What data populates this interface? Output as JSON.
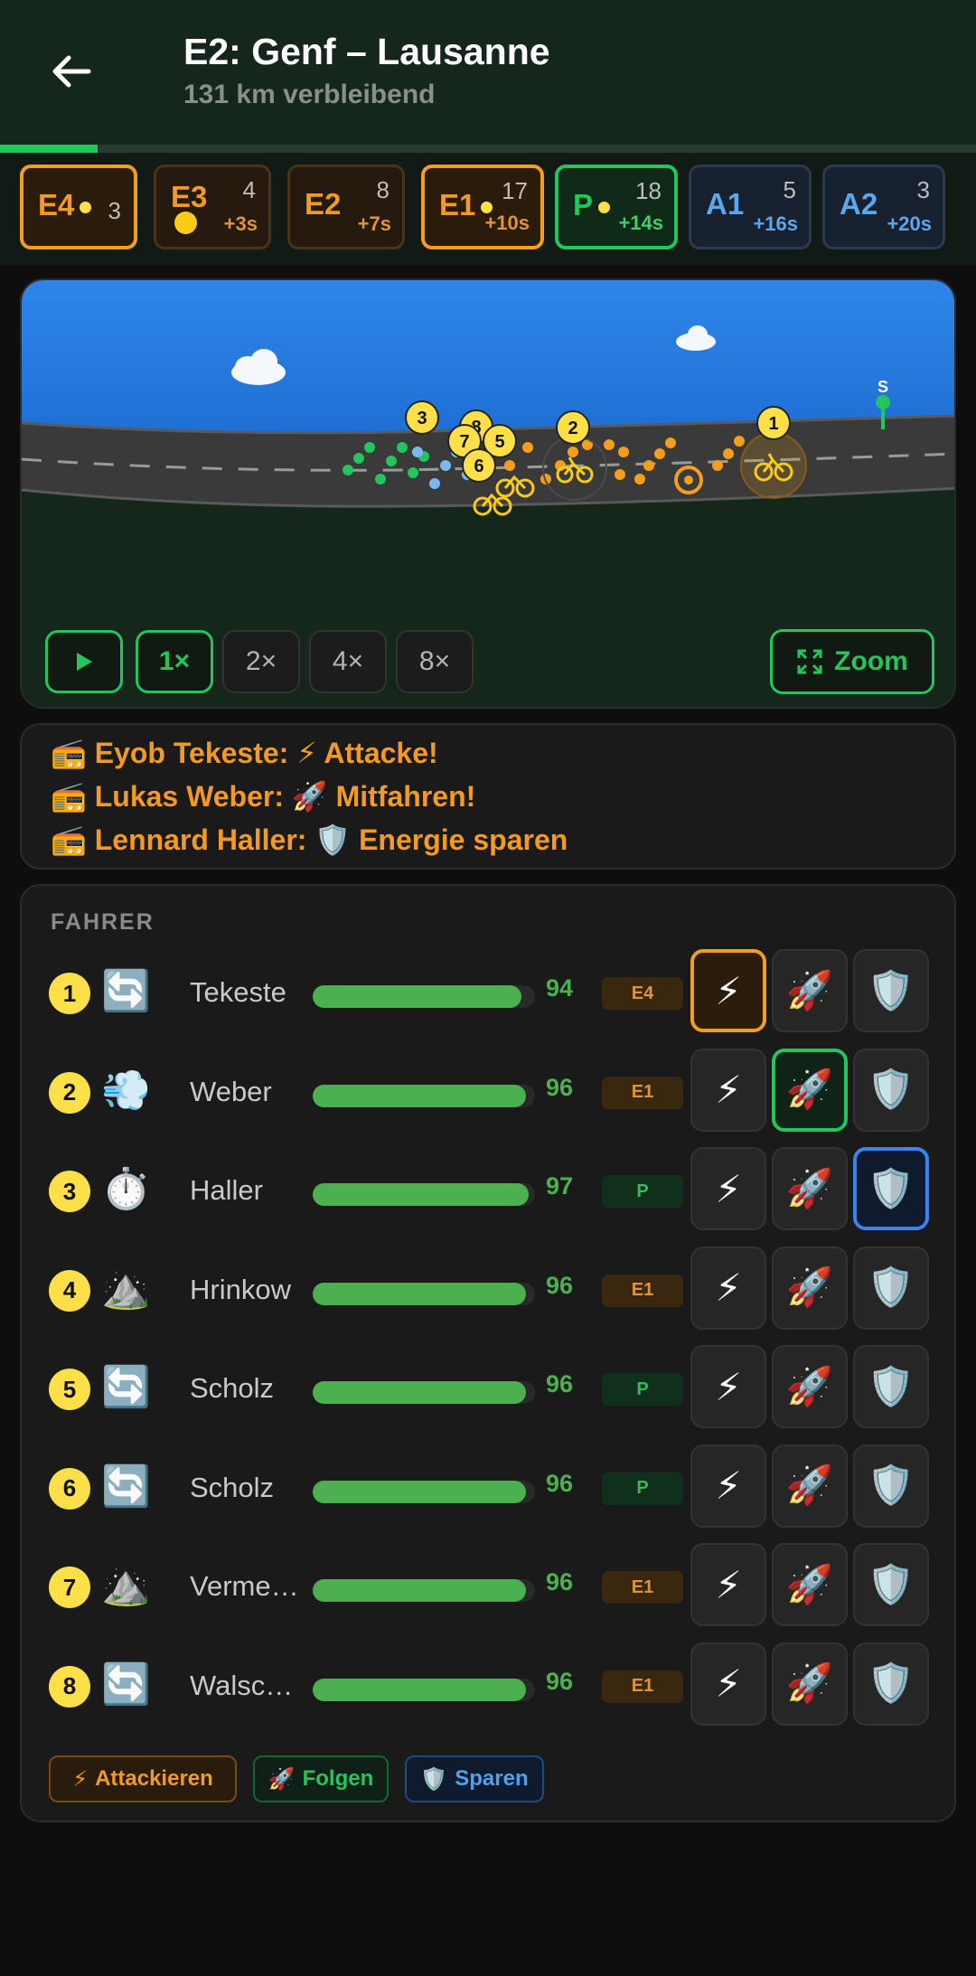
{
  "header": {
    "title": "E2: Genf – Lausanne",
    "subtitle": "131 km verbleibend",
    "stage_progress": 0.1,
    "accent": "#22c55e"
  },
  "groups": [
    {
      "label": "E4",
      "count": "3",
      "gap": "",
      "state": "selected-orange",
      "dot": true
    },
    {
      "label": "E3",
      "count": "4",
      "gap": "+3s",
      "state": "orange",
      "bigdot": true
    },
    {
      "label": "E2",
      "count": "8",
      "gap": "+7s",
      "state": "orange"
    },
    {
      "label": "E1",
      "count": "17",
      "gap": "+10s",
      "state": "selected-orange",
      "dot": true
    },
    {
      "label": "P",
      "count": "18",
      "gap": "+14s",
      "state": "selected-green",
      "dot": true
    },
    {
      "label": "A1",
      "count": "5",
      "gap": "+16s",
      "state": "blue"
    },
    {
      "label": "A2",
      "count": "3",
      "gap": "+20s",
      "state": "blue"
    }
  ],
  "race_view": {
    "sprint_marker": "S",
    "rider_labels": [
      "1",
      "2",
      "3",
      "5",
      "6",
      "7",
      "8"
    ],
    "speeds": [
      "1×",
      "2×",
      "4×",
      "8×"
    ],
    "active_speed": "1×",
    "zoom_label": "Zoom"
  },
  "feed": [
    {
      "icon": "📻",
      "text": "Eyob Tekeste: ⚡ Attacke!"
    },
    {
      "icon": "📻",
      "text": "Lukas Weber: 🚀 Mitfahren!"
    },
    {
      "icon": "📻",
      "text": "Lennard Haller: 🛡️ Energie sparen"
    }
  ],
  "riders_section": {
    "title": "FAHRER",
    "rows": [
      {
        "num": "1",
        "icon": "🔄",
        "name": "Tekeste",
        "energy": "94",
        "group": "E4",
        "group_color": "orange",
        "action": "attack"
      },
      {
        "num": "2",
        "icon": "💨",
        "name": "Weber",
        "energy": "96",
        "group": "E1",
        "group_color": "orange",
        "action": "follow"
      },
      {
        "num": "3",
        "icon": "⏱️",
        "name": "Haller",
        "energy": "97",
        "group": "P",
        "group_color": "green",
        "action": "save"
      },
      {
        "num": "4",
        "icon": "⛰️",
        "name": "Hrinkow",
        "energy": "96",
        "group": "E1",
        "group_color": "orange",
        "action": ""
      },
      {
        "num": "5",
        "icon": "🔄",
        "name": "Scholz",
        "energy": "96",
        "group": "P",
        "group_color": "green",
        "action": ""
      },
      {
        "num": "6",
        "icon": "🔄",
        "name": "Scholz",
        "energy": "96",
        "group": "P",
        "group_color": "green",
        "action": ""
      },
      {
        "num": "7",
        "icon": "⛰️",
        "name": "Vermee…",
        "energy": "96",
        "group": "E1",
        "group_color": "orange",
        "action": ""
      },
      {
        "num": "8",
        "icon": "🔄",
        "name": "Walsch…",
        "energy": "96",
        "group": "E1",
        "group_color": "orange",
        "action": ""
      }
    ],
    "action_icons": {
      "attack": "⚡",
      "follow": "🚀",
      "save": "🛡️"
    }
  },
  "legend": [
    {
      "icon": "⚡",
      "label": "Attackieren"
    },
    {
      "icon": "🚀",
      "label": "Folgen"
    },
    {
      "icon": "🛡️",
      "label": "Sparen"
    }
  ]
}
